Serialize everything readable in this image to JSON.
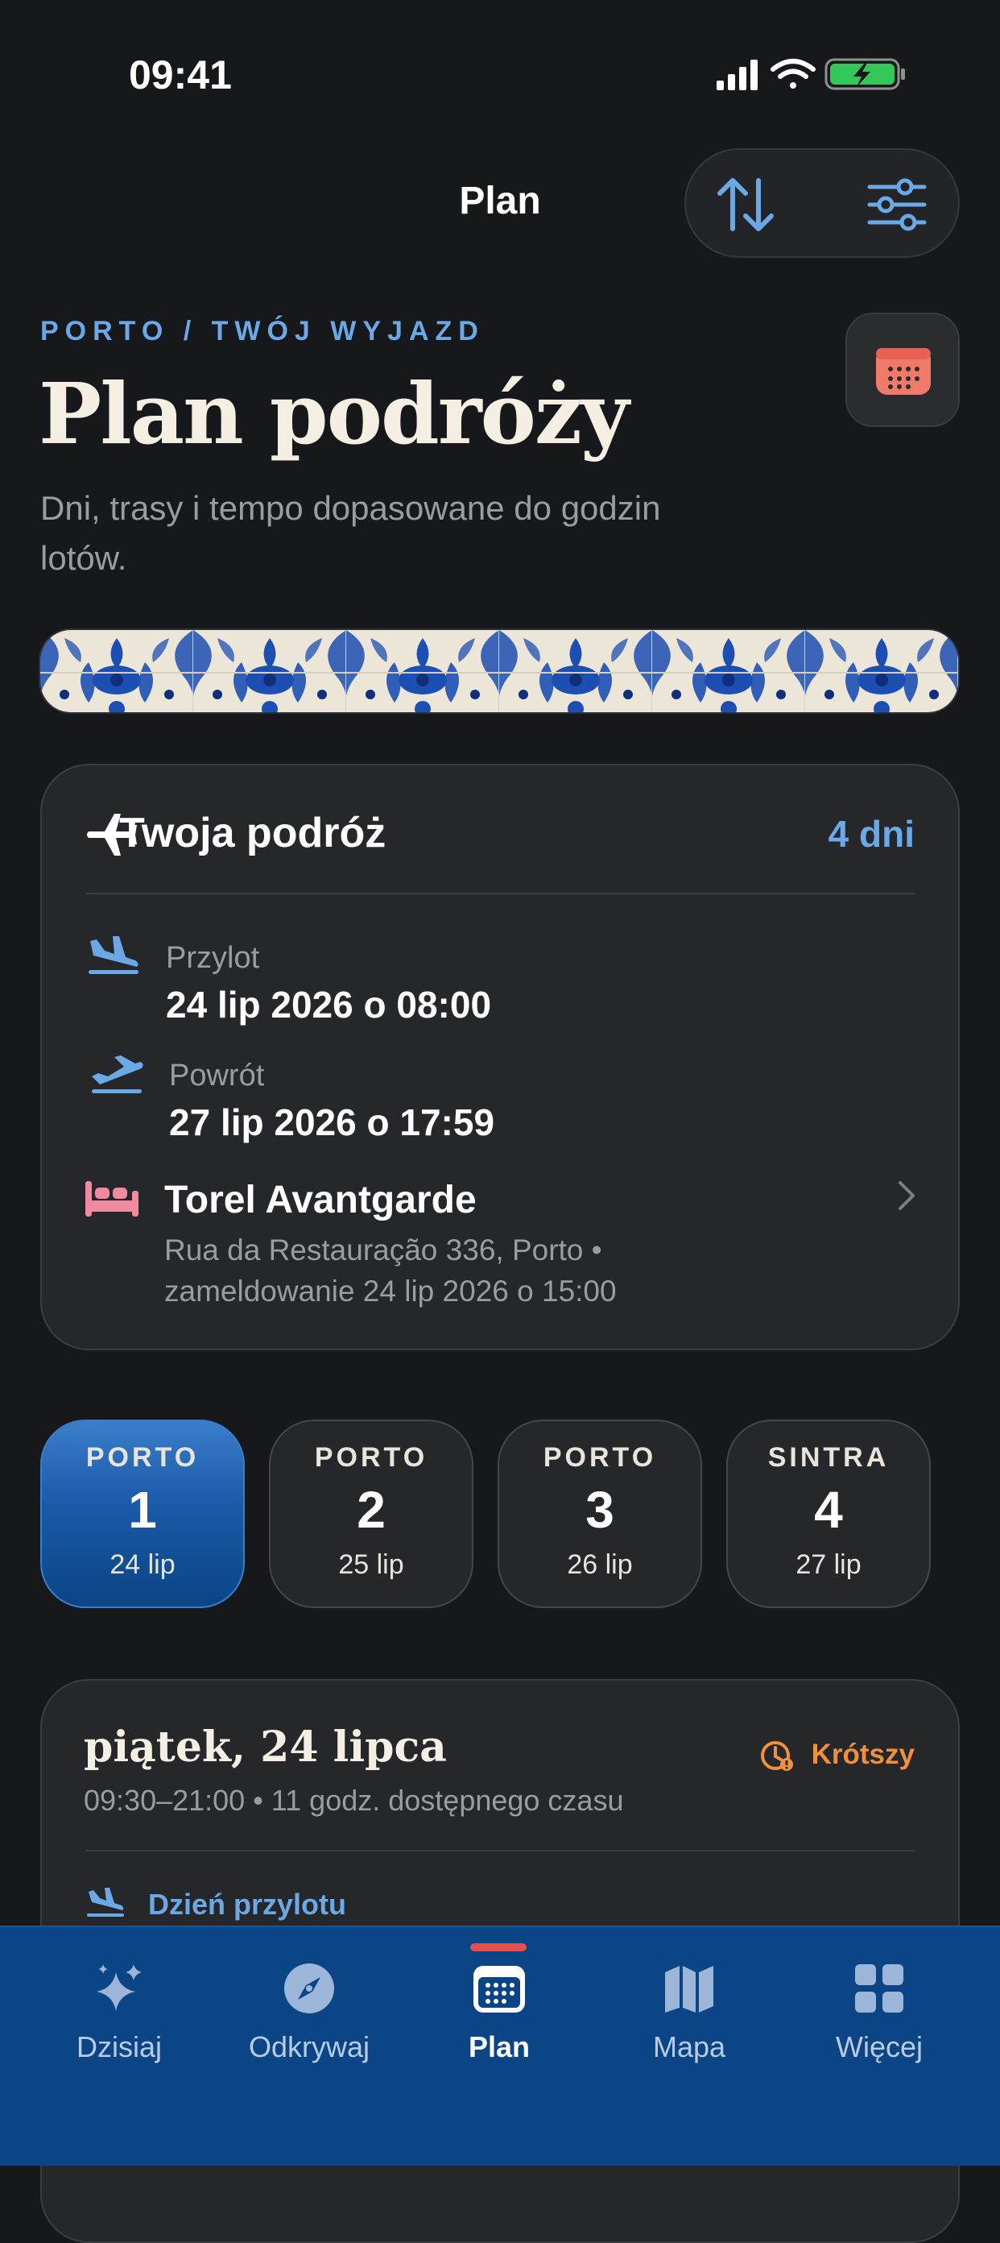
{
  "status_bar": {
    "time": "09:41"
  },
  "nav": {
    "title": "Plan"
  },
  "header": {
    "eyebrow": "PORTO / TWÓJ WYJAZD",
    "title": "Plan podróży",
    "subtitle": "Dni, trasy i tempo dopasowane do godzin lotów."
  },
  "trip": {
    "title": "Twoja podróż",
    "days": "4 dni",
    "arrival_label": "Przylot",
    "arrival_value": "24 lip 2026 o 08:00",
    "return_label": "Powrót",
    "return_value": "27 lip 2026 o 17:59",
    "hotel_name": "Torel Avantgarde",
    "hotel_details": "Rua da Restauração 336, Porto • zameldowanie 24 lip 2026 o 15:00"
  },
  "days": [
    {
      "city": "PORTO",
      "number": "1",
      "date": "24 lip",
      "selected": true
    },
    {
      "city": "PORTO",
      "number": "2",
      "date": "25 lip",
      "selected": false
    },
    {
      "city": "PORTO",
      "number": "3",
      "date": "26 lip",
      "selected": false
    },
    {
      "city": "SINTRA",
      "number": "4",
      "date": "27 lip",
      "selected": false
    }
  ],
  "day_detail": {
    "title": "piątek, 24 lipca",
    "subtitle": "09:30–21:00 • 11 godz. dostępnego czasu",
    "badge": "Krótszy",
    "arrival_row": "Dzień przylotu"
  },
  "tabs": [
    {
      "label": "Dzisiaj",
      "icon": "sparkles-icon"
    },
    {
      "label": "Odkrywaj",
      "icon": "compass-icon"
    },
    {
      "label": "Plan",
      "icon": "calendar-icon",
      "active": true
    },
    {
      "label": "Mapa",
      "icon": "map-icon"
    },
    {
      "label": "Więcej",
      "icon": "grid-icon"
    }
  ],
  "colors": {
    "background": "#17181b",
    "card": "#25272b",
    "accent_blue": "#6aa8e6",
    "tab_bar": "#0b4585",
    "warning_orange": "#f0903b",
    "coral": "#f07a6a",
    "hotel_pink": "#f08aa0"
  }
}
